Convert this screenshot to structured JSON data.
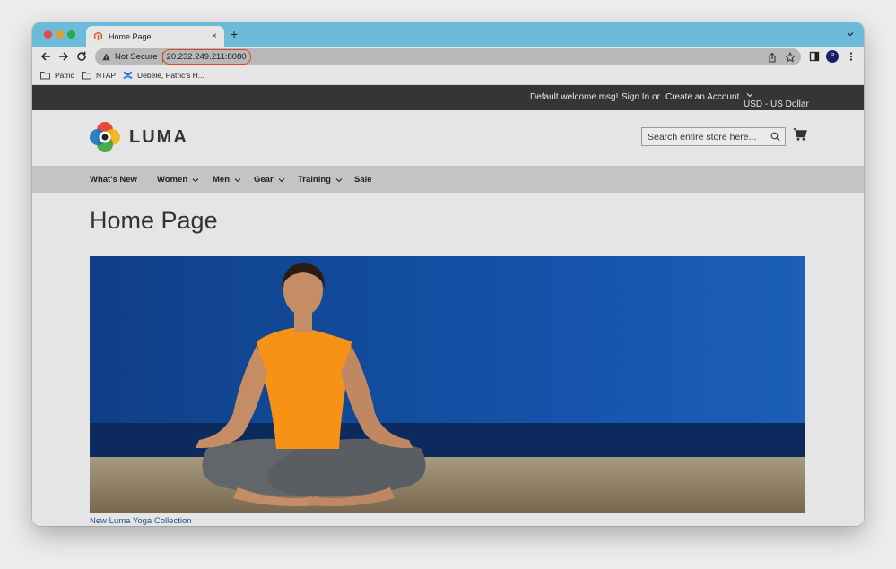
{
  "browser": {
    "tab_title": "Home Page",
    "close_glyph": "×",
    "new_tab_glyph": "+",
    "security_label": "Not Secure",
    "url": "20.232.249.211:8080",
    "profile_initial": "P",
    "bookmarks": [
      {
        "label": "Patric",
        "icon": "folder-icon"
      },
      {
        "label": "NTAP",
        "icon": "folder-icon"
      },
      {
        "label": "Uebele, Patric's H...",
        "icon": "confluence-icon"
      }
    ],
    "colors": {
      "tabstrip": "#6cbcd9",
      "url_highlight": "#d9481f"
    }
  },
  "store": {
    "top_links": {
      "welcome": "Default welcome msg!",
      "sign_in": "Sign In",
      "or": "or",
      "create_account": "Create an Account",
      "currency": "USD - US Dollar"
    },
    "logo_text": "LUMA",
    "search_placeholder": "Search entire store here...",
    "nav": [
      {
        "label": "What's New",
        "has_dropdown": false
      },
      {
        "label": "Women",
        "has_dropdown": true
      },
      {
        "label": "Men",
        "has_dropdown": true
      },
      {
        "label": "Gear",
        "has_dropdown": true
      },
      {
        "label": "Training",
        "has_dropdown": true
      },
      {
        "label": "Sale",
        "has_dropdown": false
      }
    ],
    "page_title": "Home Page",
    "hero_caption": "New Luma Yoga Collection",
    "colors": {
      "topbar": "#333634",
      "nav": "#c4c4c4",
      "caption_link": "#1d4f8c"
    }
  }
}
